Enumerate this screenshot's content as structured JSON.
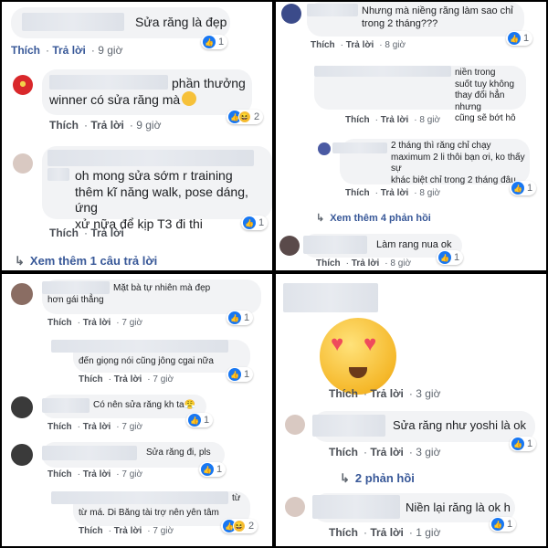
{
  "labels": {
    "like": "Thích",
    "reply": "Trả lời"
  },
  "panel1": {
    "c1": {
      "text": "Sửa răng là đẹp",
      "time": "9 giờ",
      "reactions": "1"
    },
    "c2": {
      "text_top": "phần thưởng",
      "text": "winner có sửa răng mà",
      "time": "9 giờ",
      "reactions": "2"
    },
    "c3": {
      "text": "oh mong sửa sớm r training\nthêm kĩ năng walk, pose dáng, ứng\nxử nữa để kịp T3 đi thi",
      "time": "",
      "reactions": "1"
    },
    "more": "Xem thêm 1 câu trả lời"
  },
  "panel2": {
    "c1": {
      "text": "Nhưng mà niềng răng làm sao chỉ\ntrong 2 tháng???",
      "time": "8 giờ",
      "reactions": "1"
    },
    "c2": {
      "text": "niền trong\nsuốt tuy không thay đổi hẳn nhưng\ncũng sẽ bớt hô",
      "time": "8 giờ"
    },
    "c3": {
      "text": "2 tháng thì răng chỉ chạy\nmaximum 2 li thôi bạn ơi, ko thấy sự\nkhác biệt chỉ trong 2 tháng đâu.",
      "time": "8 giờ",
      "reactions": "1"
    },
    "more": "Xem thêm 4 phản hồi",
    "c4": {
      "text": "Làm rang nua ok",
      "time": "8 giờ",
      "reactions": "1"
    }
  },
  "panel3": {
    "c1": {
      "text": "Mặt bà tự nhiên mà đẹp\nhơn gái thẳng",
      "time": "7 giờ",
      "reactions": "1"
    },
    "c2": {
      "text": "đến giọng nói cũng jông cgai nữa",
      "time": "7 giờ",
      "reactions": "1"
    },
    "c3": {
      "text": "Có nên sửa răng kh ta😤",
      "time": "7 giờ",
      "reactions": "1"
    },
    "c4": {
      "text": "Sửa răng đi, pls",
      "time": "7 giờ",
      "reactions": "1"
    },
    "c5": {
      "text_top": "từ",
      "text": "từ má. Di Băng tài trợ nên yên tâm",
      "time": "7 giờ",
      "reactions": "2"
    }
  },
  "panel4": {
    "c1": {
      "time": "3 giờ"
    },
    "c2": {
      "text": "Sửa răng như yoshi là ok",
      "time": "3 giờ",
      "reactions": "1"
    },
    "more": "2 phản hồi",
    "c3": {
      "text": "Niền lại răng là ok h",
      "time": "1 giờ",
      "reactions": "1"
    }
  }
}
